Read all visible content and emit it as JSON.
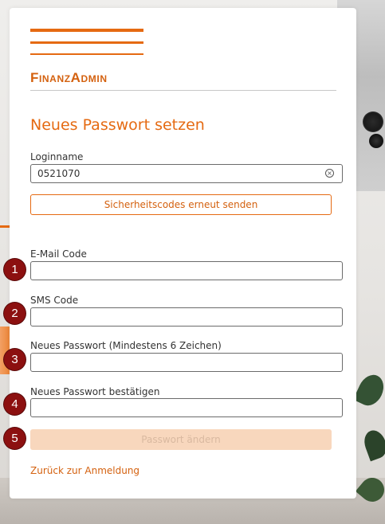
{
  "brand": {
    "logo_text": "FinanzAdmin",
    "accent": "#e56a12"
  },
  "page": {
    "title": "Neues Passwort setzen"
  },
  "login": {
    "label": "Loginname",
    "value": "0521070"
  },
  "resend_button": "Sicherheitscodes erneut senden",
  "email_code": {
    "label": "E-Mail Code",
    "value": ""
  },
  "sms_code": {
    "label": "SMS Code",
    "value": ""
  },
  "new_password": {
    "label": "Neues Passwort (Mindestens 6 Zeichen)",
    "value": ""
  },
  "confirm_password": {
    "label": "Neues Passwort bestätigen",
    "value": ""
  },
  "submit_button": "Passwort ändern",
  "back_link": "Zurück zur Anmeldung",
  "badges": [
    "1",
    "2",
    "3",
    "4",
    "5"
  ]
}
